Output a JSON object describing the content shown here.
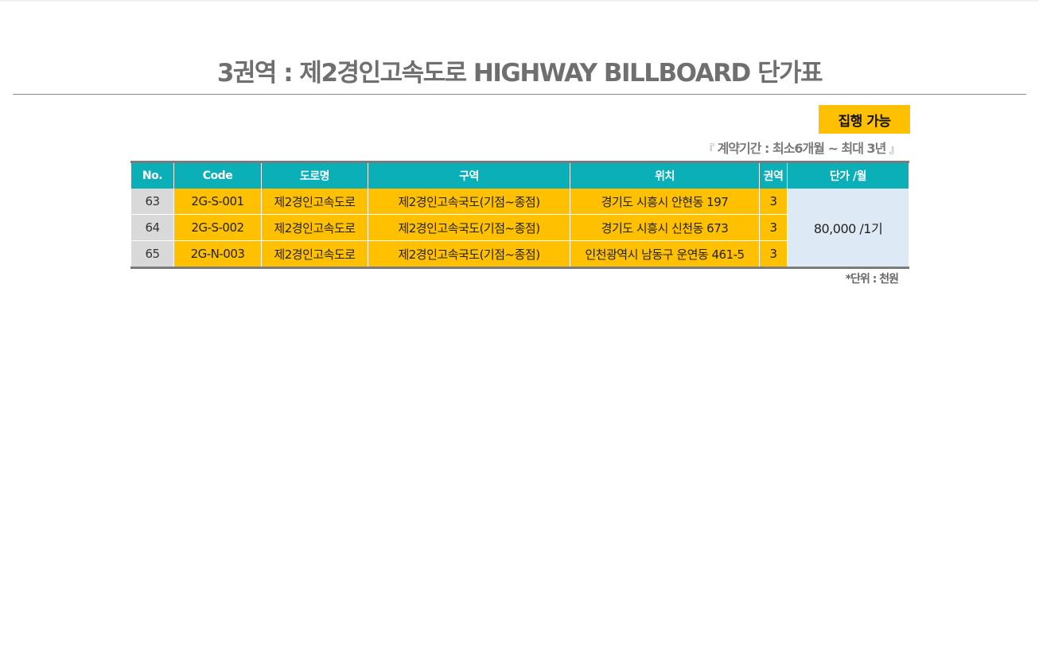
{
  "page": {
    "title": "3권역 : 제2경인고속도로 HIGHWAY BILLBOARD 단가표",
    "status_badge": "집행 가능",
    "contract_period": {
      "open": "『",
      "text": "계약기간 :  최소6개월 ~ 최대 3년",
      "close": "』"
    },
    "unit_note": "*단위 : 천원"
  },
  "table": {
    "headers": [
      "No.",
      "Code",
      "도로명",
      "구역",
      "위치",
      "권역",
      "단가 /월"
    ],
    "rows": [
      {
        "no": "63",
        "code": "2G-S-001",
        "road": "제2경인고속도로",
        "section": "제2경인고속국도(기점~종점)",
        "location": "경기도 시흥시 안현동 197",
        "zone": "3"
      },
      {
        "no": "64",
        "code": "2G-S-002",
        "road": "제2경인고속도로",
        "section": "제2경인고속국도(기점~종점)",
        "location": "경기도 시흥시 신천동 673",
        "zone": "3"
      },
      {
        "no": "65",
        "code": "2G-N-003",
        "road": "제2경인고속도로",
        "section": "제2경인고속국도(기점~종점)",
        "location": "인천광역시 남동구 운연동 461-5",
        "zone": "3"
      }
    ],
    "price": "80,000 /1기"
  },
  "colors": {
    "header_bg": "#0aafb8",
    "highlight": "#ffc000",
    "no_cell": "#d9d9d9",
    "price_cell": "#dde9f5",
    "title_text": "#6f6f6f"
  }
}
